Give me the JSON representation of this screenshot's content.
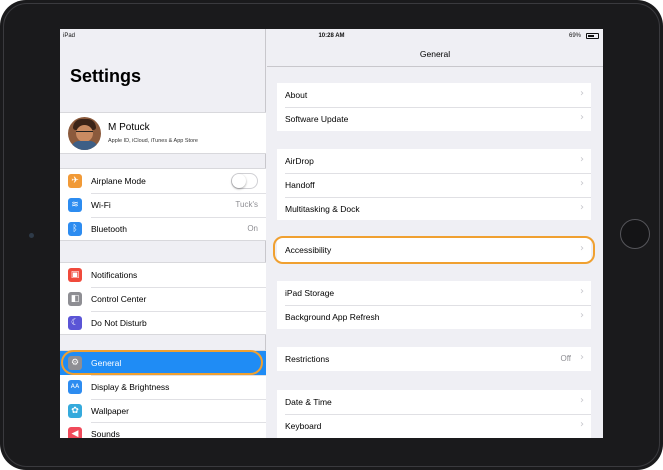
{
  "status_bar": {
    "carrier": "iPad",
    "time": "10:28 AM",
    "battery": "69%"
  },
  "left_pane": {
    "title": "Settings",
    "profile": {
      "name": "M Potuck",
      "subtitle": "Apple ID, iCloud, iTunes & App Store"
    },
    "groups": [
      [
        {
          "label": "Airplane Mode",
          "icon": "airplane-icon",
          "icon_color": "#f19a37",
          "glyph": "✈",
          "control": "toggle",
          "toggle_on": false
        },
        {
          "label": "Wi-Fi",
          "icon": "wifi-icon",
          "icon_color": "#2d8cf0",
          "glyph": "≋",
          "value": "Tuck's"
        },
        {
          "label": "Bluetooth",
          "icon": "bluetooth-icon",
          "icon_color": "#2d8cf0",
          "glyph": "ᛒ",
          "value": "On"
        }
      ],
      [
        {
          "label": "Notifications",
          "icon": "notifications-icon",
          "icon_color": "#f04a3c",
          "glyph": "▣"
        },
        {
          "label": "Control Center",
          "icon": "control-center-icon",
          "icon_color": "#8e8e93",
          "glyph": "◧"
        },
        {
          "label": "Do Not Disturb",
          "icon": "moon-icon",
          "icon_color": "#5b55d6",
          "glyph": "☾"
        }
      ],
      [
        {
          "label": "General",
          "icon": "gear-icon",
          "icon_color": "#8e8e93",
          "glyph": "⚙",
          "selected": true
        },
        {
          "label": "Display & Brightness",
          "icon": "display-brightness-icon",
          "icon_color": "#2d8cf0",
          "glyph": "AA"
        },
        {
          "label": "Wallpaper",
          "icon": "wallpaper-icon",
          "icon_color": "#35aadc",
          "glyph": "✿"
        },
        {
          "label": "Sounds",
          "icon": "sounds-icon",
          "icon_color": "#f04a5a",
          "glyph": "◀"
        }
      ]
    ]
  },
  "right_pane": {
    "title": "General",
    "groups": [
      [
        {
          "label": "About"
        },
        {
          "label": "Software Update"
        }
      ],
      [
        {
          "label": "AirDrop"
        },
        {
          "label": "Handoff"
        },
        {
          "label": "Multitasking & Dock"
        }
      ],
      [
        {
          "label": "Accessibility",
          "highlighted": true
        }
      ],
      [
        {
          "label": "iPad Storage"
        },
        {
          "label": "Background App Refresh"
        }
      ],
      [
        {
          "label": "Restrictions",
          "value": "Off"
        }
      ],
      [
        {
          "label": "Date & Time"
        },
        {
          "label": "Keyboard"
        }
      ]
    ]
  },
  "colors": {
    "accent": "#1f8cf5",
    "highlight_ring": "#f0a030",
    "background": "#efeff4"
  }
}
